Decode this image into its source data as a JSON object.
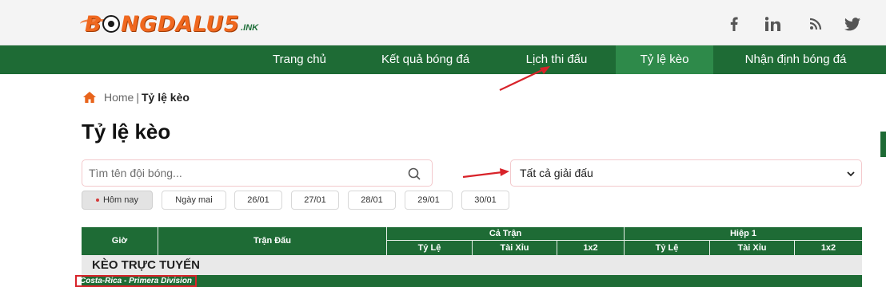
{
  "header": {
    "logo_text_a": "B",
    "logo_text_b": "NGDALU5",
    "logo_suffix": ".INK",
    "social": [
      {
        "name": "facebook-icon",
        "glyph": "f"
      },
      {
        "name": "linkedin-icon",
        "glyph": "in"
      },
      {
        "name": "rss-icon",
        "glyph": "rss"
      },
      {
        "name": "twitter-icon",
        "glyph": "bird"
      }
    ]
  },
  "nav": {
    "items": [
      "Trang chủ",
      "Kết quả bóng đá",
      "Lịch thi đấu",
      "Tỷ lệ kèo",
      "Nhận định bóng đá"
    ],
    "active_index": 3
  },
  "breadcrumb": {
    "home": "Home",
    "separator": "|",
    "current": "Tỷ lệ kèo"
  },
  "page_title": "Tỷ lệ kèo",
  "search": {
    "placeholder": "Tìm tên đội bóng...",
    "value": ""
  },
  "league_select": {
    "selected": "Tất cả giải đấu"
  },
  "date_filters": [
    "Hôm nay",
    "Ngày mai",
    "26/01",
    "27/01",
    "28/01",
    "29/01",
    "30/01"
  ],
  "table": {
    "headers": {
      "gio": "Giờ",
      "tran_dau": "Trận Đấu",
      "ca_tran": "Cả Trận",
      "hiep1": "Hiệp 1",
      "sub": [
        "Tỷ Lệ",
        "Tài Xỉu",
        "1x2",
        "Tỷ Lệ",
        "Tài Xỉu",
        "1x2"
      ]
    },
    "section_title": "KÈO TRỰC TUYẾN",
    "league_row": "Costa-Rica - Primera Division"
  },
  "colors": {
    "primary_green": "#1e6b35",
    "active_green": "#2e8a4a",
    "brand_orange": "#f0681f",
    "annotation_red": "#d8232a"
  }
}
